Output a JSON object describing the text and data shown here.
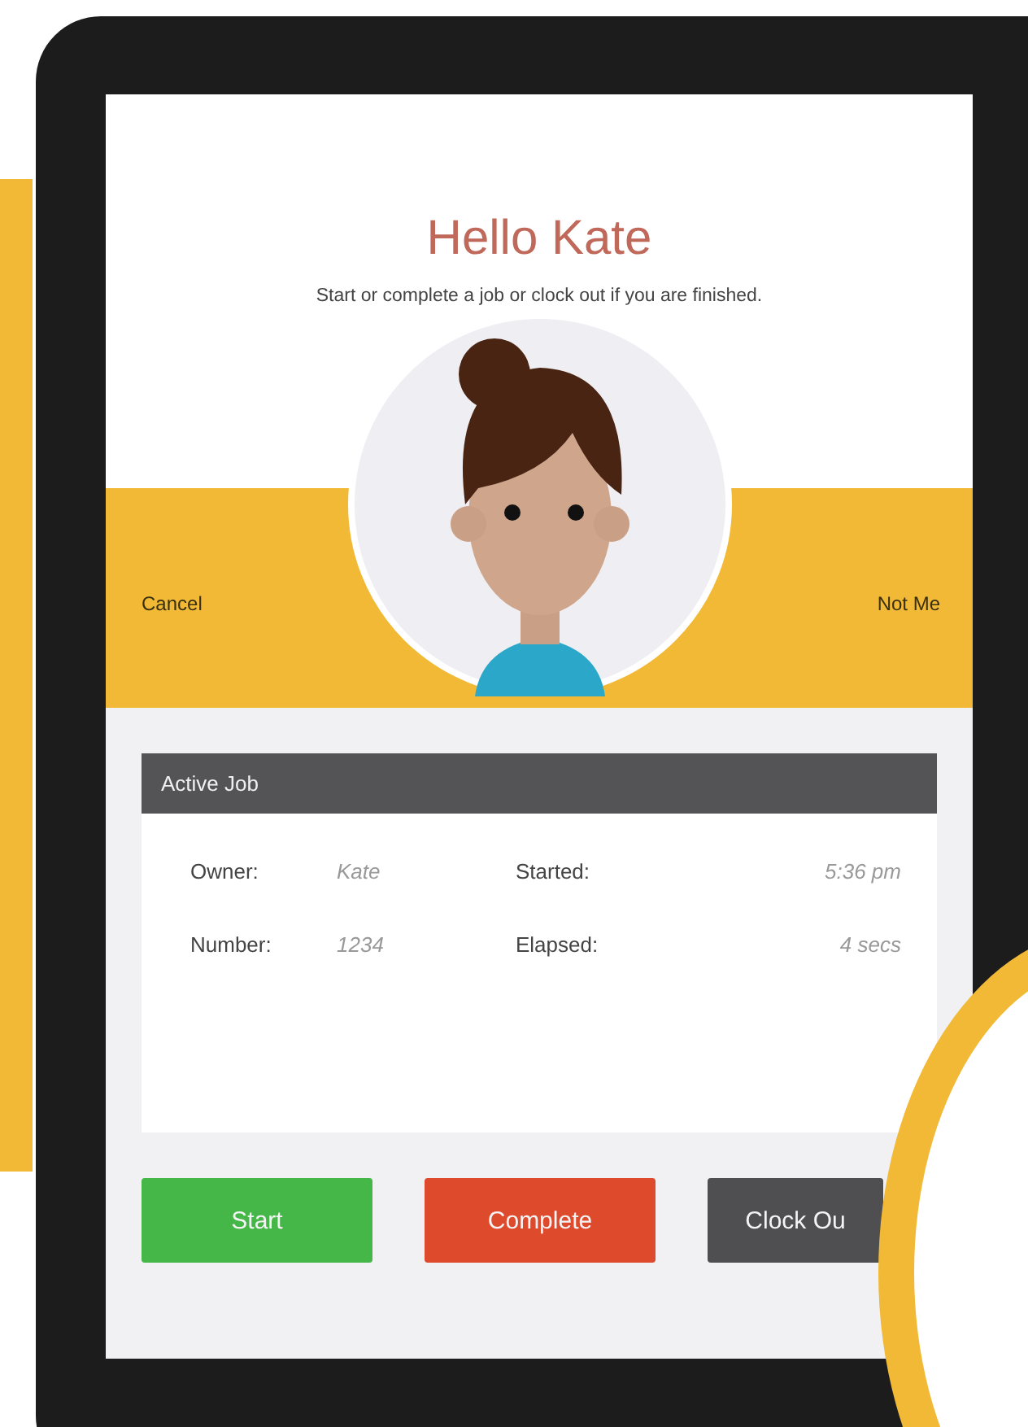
{
  "header": {
    "title": "Hello Kate",
    "subtitle": "Start or complete a job or clock out if you are finished."
  },
  "identity_bar": {
    "left_action": "Cancel",
    "right_action": "Not Me"
  },
  "active_job": {
    "title": "Active Job",
    "fields": [
      {
        "label": "Owner:",
        "value": "Kate"
      },
      {
        "label": "Started:",
        "value": "5:36 pm"
      },
      {
        "label": "Number:",
        "value": "1234"
      },
      {
        "label": "Elapsed:",
        "value": "4 secs"
      }
    ]
  },
  "buttons": [
    {
      "kind": "start",
      "label": "Start"
    },
    {
      "kind": "complete",
      "label": "Complete"
    },
    {
      "kind": "clock_out",
      "label": "Clock Ou"
    }
  ]
}
